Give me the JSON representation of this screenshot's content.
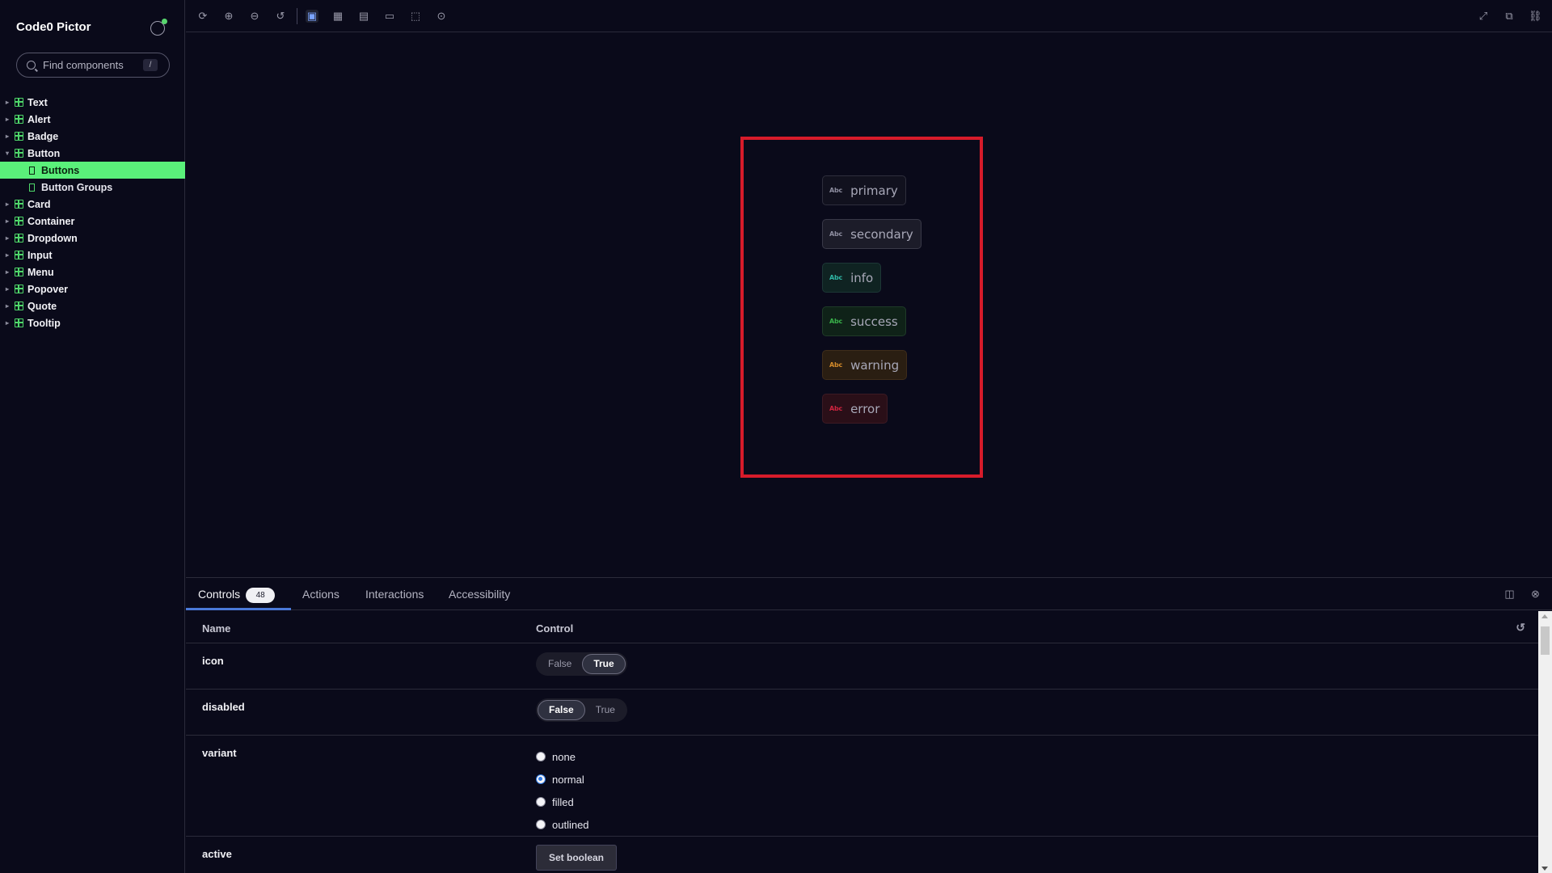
{
  "app": {
    "title": "Code0 Pictor"
  },
  "search": {
    "placeholder": "Find components",
    "shortcut": "/"
  },
  "sidebar": {
    "items": [
      {
        "label": "Text"
      },
      {
        "label": "Alert"
      },
      {
        "label": "Badge"
      },
      {
        "label": "Button",
        "expanded": true
      },
      {
        "label": "Card"
      },
      {
        "label": "Container"
      },
      {
        "label": "Dropdown"
      },
      {
        "label": "Input"
      },
      {
        "label": "Menu"
      },
      {
        "label": "Popover"
      },
      {
        "label": "Quote"
      },
      {
        "label": "Tooltip"
      }
    ],
    "button_children": [
      {
        "label": "Buttons",
        "active": true
      },
      {
        "label": "Button Groups"
      }
    ]
  },
  "toolbar": {
    "icons": [
      "reload-icon",
      "zoom-in-icon",
      "zoom-out-icon",
      "zoom-reset-icon",
      "image-background-icon",
      "grid-icon",
      "viewport-icon",
      "measure-icon",
      "outline-icon",
      "accessibility-icon"
    ],
    "right_icons": [
      "fullscreen-icon",
      "open-new-tab-icon",
      "copy-link-icon"
    ]
  },
  "preview": {
    "icon_text": "Abc",
    "buttons": [
      {
        "label": "primary",
        "variant": "primary"
      },
      {
        "label": "secondary",
        "variant": "secondary"
      },
      {
        "label": "info",
        "variant": "info"
      },
      {
        "label": "success",
        "variant": "success"
      },
      {
        "label": "warning",
        "variant": "warning"
      },
      {
        "label": "error",
        "variant": "error"
      }
    ],
    "colors": {
      "frame": "#d71b2a",
      "info": "#2fb6a4",
      "success": "#39b24a",
      "warning": "#d28a2a",
      "error": "#d0243f"
    }
  },
  "panel": {
    "tabs": [
      {
        "label": "Controls",
        "count": "48",
        "active": true
      },
      {
        "label": "Actions"
      },
      {
        "label": "Interactions"
      },
      {
        "label": "Accessibility"
      }
    ],
    "table": {
      "col_name": "Name",
      "col_control": "Control"
    },
    "rows": {
      "icon": {
        "name": "icon",
        "false_label": "False",
        "true_label": "True",
        "value": "True"
      },
      "disabled": {
        "name": "disabled",
        "false_label": "False",
        "true_label": "True",
        "value": "False"
      },
      "variant": {
        "name": "variant",
        "options": [
          "none",
          "normal",
          "filled",
          "outlined"
        ],
        "value": "normal"
      },
      "active": {
        "name": "active",
        "button_label": "Set boolean"
      }
    },
    "accent": "#4b79d8"
  }
}
